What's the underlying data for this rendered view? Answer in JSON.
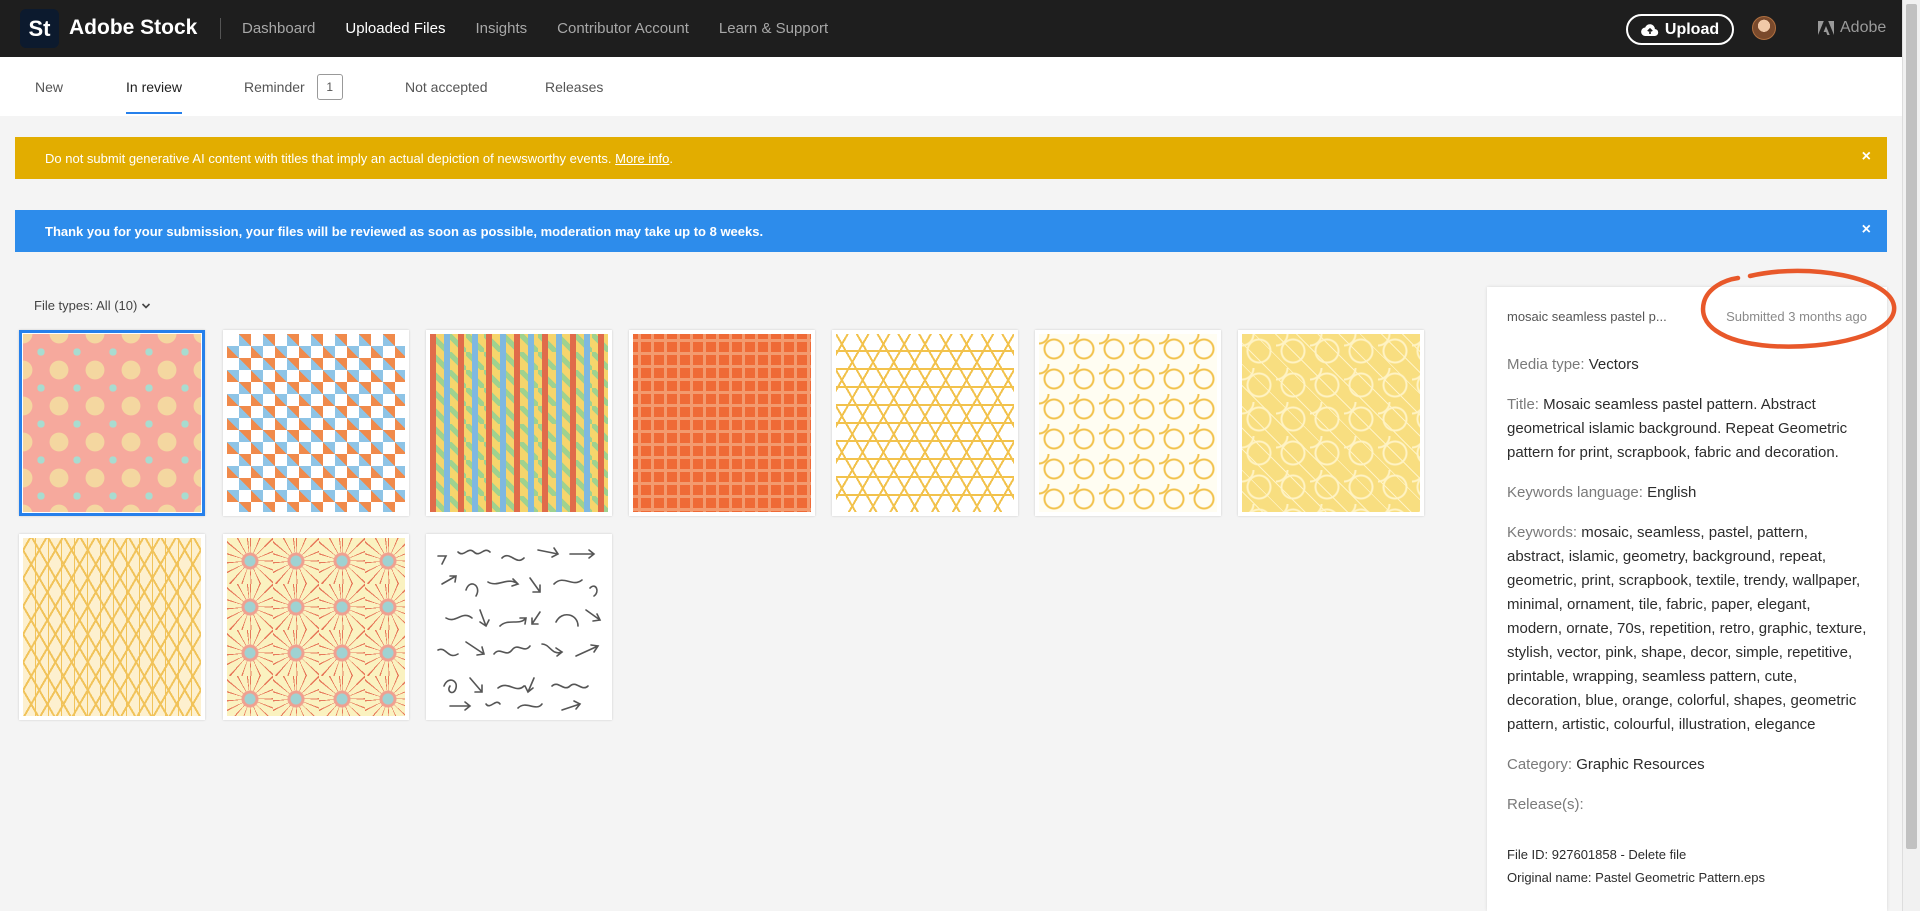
{
  "header": {
    "logo": "St",
    "brand": "Adobe Stock",
    "nav": [
      "Dashboard",
      "Uploaded Files",
      "Insights",
      "Contributor Account",
      "Learn & Support"
    ],
    "active_nav": "Uploaded Files",
    "upload_label": "Upload",
    "adobe_label": "Adobe"
  },
  "tabs": {
    "new": "New",
    "in_review": "In review",
    "reminder": "Reminder",
    "reminder_count": "1",
    "not_accepted": "Not accepted",
    "releases": "Releases"
  },
  "banners": {
    "warning_text": "Do not submit generative AI content with titles that imply an actual depiction of newsworthy events.",
    "warning_link": "More info",
    "warning_tail": ".",
    "info_text": "Thank you for your submission, your files will be reviewed as soon as possible, moderation may take up to 8 weeks.",
    "close": "×"
  },
  "filter": {
    "label": "File types: All (10)"
  },
  "thumbnails": [
    "Pink mosaic pattern",
    "Orange blue square pattern",
    "Multicolor diamond pattern",
    "Orange square pattern",
    "Yellow line geometric pattern",
    "Cream floral geometric pattern",
    "Yellow islamic pattern",
    "Yellow lattice pattern",
    "Mandala floral pattern",
    "Arrow doodle pattern"
  ],
  "details": {
    "short_title": "mosaic seamless pastel p...",
    "submitted": "Submitted 3 months ago",
    "media_type_label": "Media type:",
    "media_type": "Vectors",
    "title_label": "Title:",
    "title": "Mosaic seamless pastel pattern. Abstract geometrical islamic background. Repeat Geometric pattern for print, scrapbook, fabric and decoration.",
    "keywords_language_label": "Keywords language:",
    "keywords_language": "English",
    "keywords_label": "Keywords:",
    "keywords": "mosaic, seamless, pastel, pattern, abstract, islamic, geometry, background, repeat, geometric, print, scrapbook, textile, trendy, wallpaper, minimal, ornament, tile, fabric, paper, elegant, modern, ornate, 70s, repetition, retro, graphic, texture, stylish, vector, pink, shape, decor, simple, repetitive, printable, wrapping, seamless pattern, cute, decoration, blue, orange, colorful, shapes, geometric pattern, artistic, colourful, illustration, elegance",
    "category_label": "Category:",
    "category": "Graphic Resources",
    "releases_label": "Release(s):",
    "file_id": "File ID: 927601858",
    "delete": "Delete file",
    "original_name": "Original name: Pastel Geometric Pattern.eps"
  },
  "colors": {
    "accent": "#2680eb",
    "warning": "#e2ad00",
    "info": "#2d8ceb",
    "annotation": "#e8582a"
  }
}
